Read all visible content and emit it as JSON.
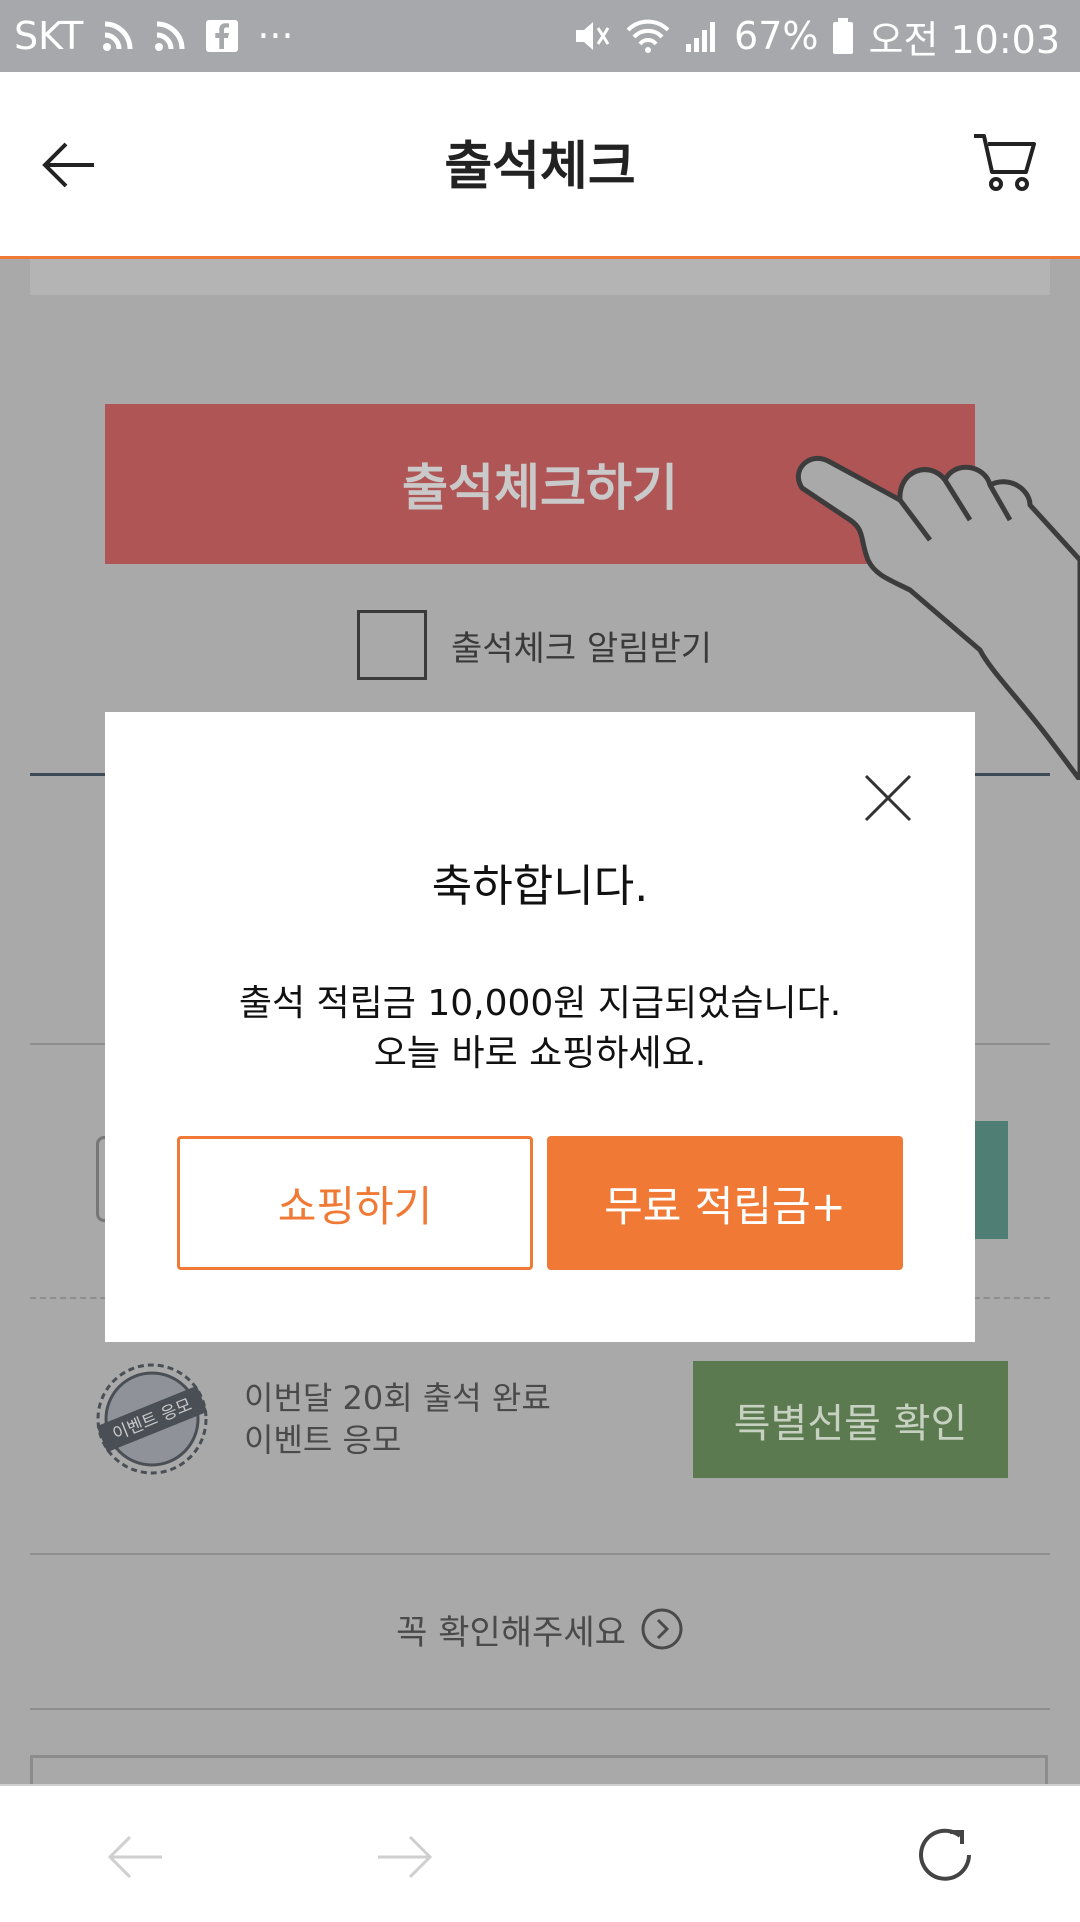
{
  "status_bar": {
    "carrier": "SKT",
    "more": "···",
    "battery": "67%",
    "time": "오전 10:03"
  },
  "header": {
    "title": "출석체크"
  },
  "page": {
    "checkin_button": "출석체크하기",
    "notify_label": "출석체크 알림받기",
    "event_badge_text": "이벤트 응모",
    "event_line1": "이번달 20회 출석 완료",
    "event_line2": "이벤트 응모",
    "gift_button": "특별선물 확인",
    "confirm_link": "꼭 확인해주세요"
  },
  "modal": {
    "title": "축하합니다.",
    "message_line1": "출석 적립금 10,000원 지급되었습니다.",
    "message_line2": "오늘 바로 쇼핑하세요.",
    "shop_button": "쇼핑하기",
    "points_button": "무료 적립금+"
  },
  "colors": {
    "accent": "#f07a35",
    "checkin_red": "#b05555",
    "gift_green": "#5c7a4f",
    "teal": "#4e7e74"
  },
  "icons": {
    "back": "arrow-left-icon",
    "cart": "cart-icon",
    "close": "close-icon",
    "hand": "pointing-hand-icon",
    "badge": "event-stamp-icon",
    "chevron": "chevron-right-circle-icon",
    "browser_back": "arrow-left-icon",
    "browser_forward": "arrow-right-icon",
    "refresh": "refresh-icon"
  }
}
